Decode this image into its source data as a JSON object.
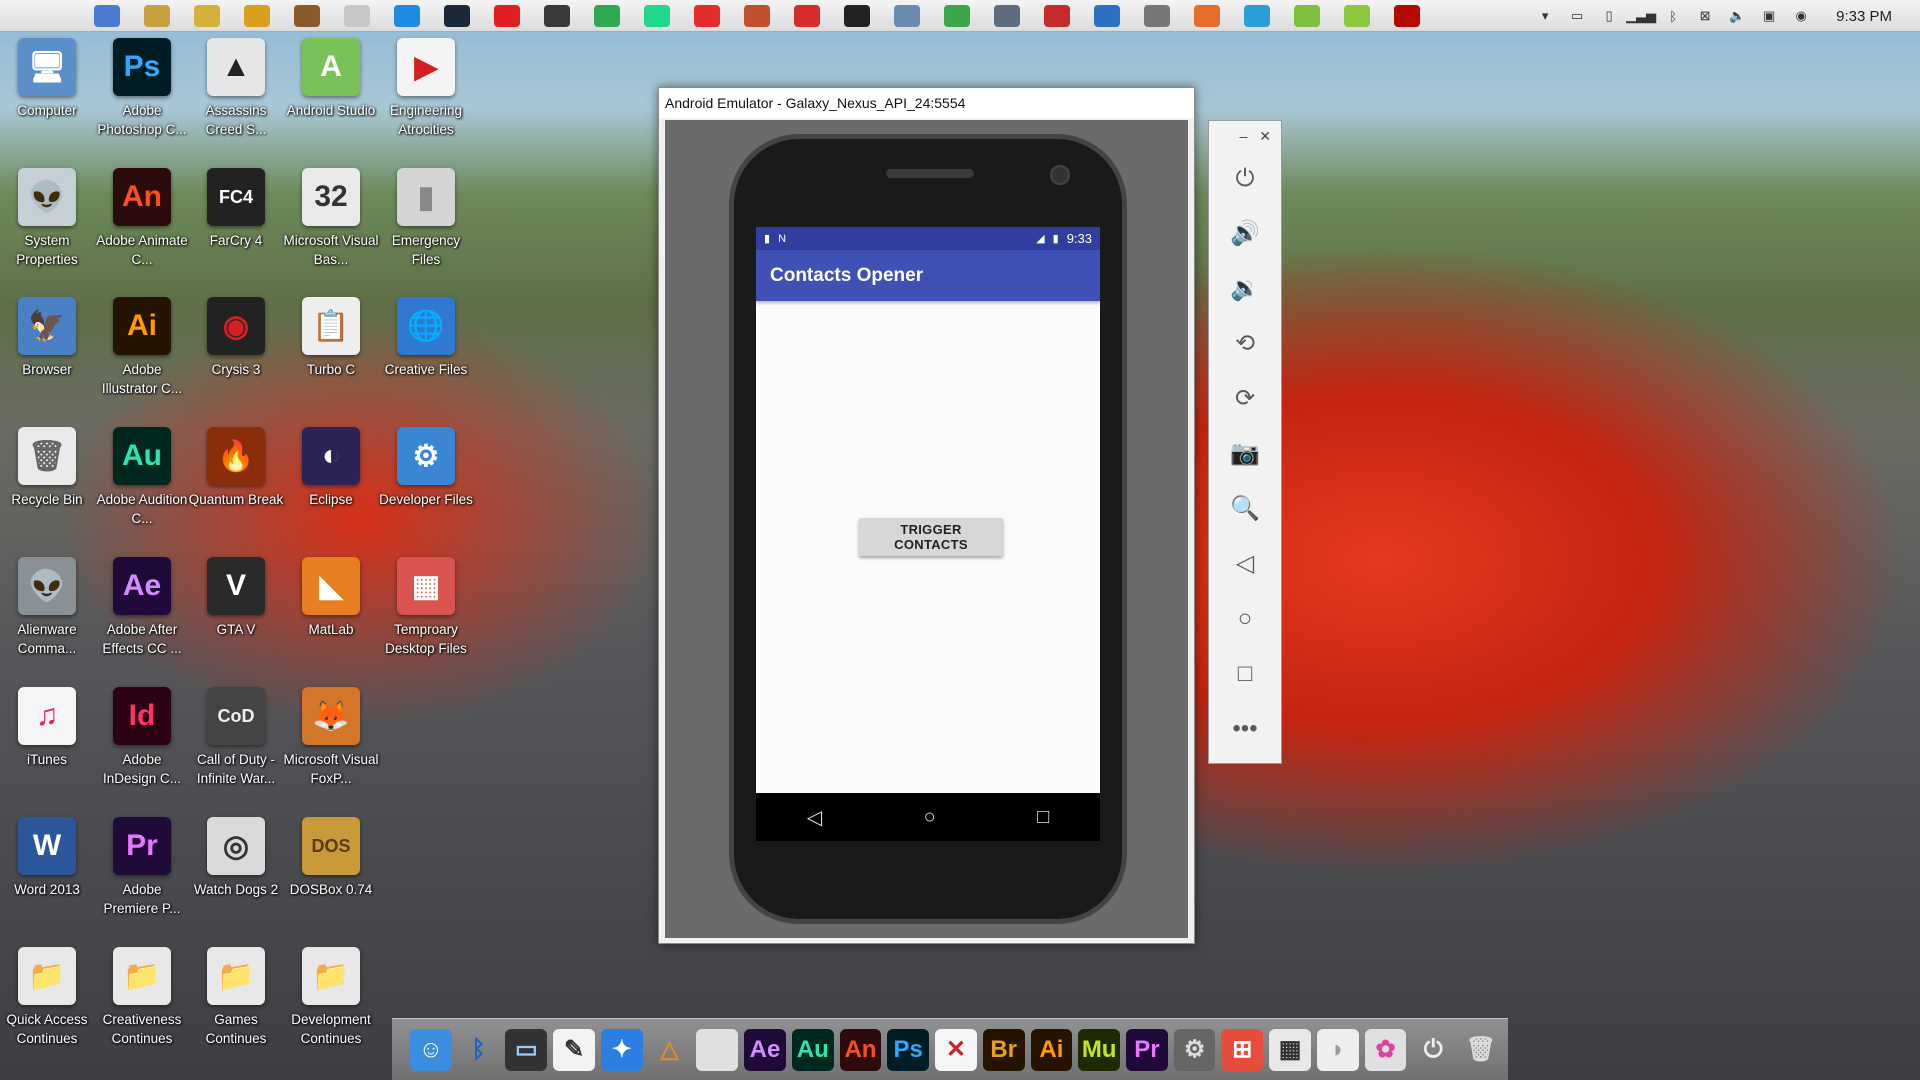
{
  "menubar": {
    "apple_glyph": "",
    "apps": [
      {
        "icon": "finder-icon",
        "color": "#4a7bd0"
      },
      {
        "icon": "folder-icon",
        "color": "#c9a23d"
      },
      {
        "icon": "bug-icon",
        "color": "#d4b13a"
      },
      {
        "icon": "r-app-icon",
        "color": "#d9a020"
      },
      {
        "icon": "box-icon",
        "color": "#8a5a2b"
      },
      {
        "icon": "leaf-icon",
        "color": "#c8c8c8"
      },
      {
        "icon": "gear-blue-icon",
        "color": "#1d8be0"
      },
      {
        "icon": "steam-icon",
        "color": "#1b2838"
      },
      {
        "icon": "m-red-icon",
        "color": "#e02020"
      },
      {
        "icon": "settings-icon",
        "color": "#3a3a3a"
      },
      {
        "icon": "green-doc-icon",
        "color": "#2fa84f"
      },
      {
        "icon": "pycharm-icon",
        "color": "#21d789"
      },
      {
        "icon": "download-icon",
        "color": "#e32d2d"
      },
      {
        "icon": "puzzle-icon",
        "color": "#c14f2d"
      },
      {
        "icon": "red-arrow-icon",
        "color": "#d42b2b"
      },
      {
        "icon": "chart-icon",
        "color": "#222222"
      },
      {
        "icon": "speed-icon",
        "color": "#6b8bb0"
      },
      {
        "icon": "globe-icon",
        "color": "#3aa64a"
      },
      {
        "icon": "chip-icon",
        "color": "#5d6d7e"
      },
      {
        "icon": "pdf-icon",
        "color": "#c72c2c"
      },
      {
        "icon": "shield-icon",
        "color": "#2d6fc2"
      },
      {
        "icon": "database-icon",
        "color": "#777777"
      },
      {
        "icon": "pen-icon",
        "color": "#e46d2a"
      },
      {
        "icon": "infinity-icon",
        "color": "#2a9fd6"
      },
      {
        "icon": "android-active-icon",
        "color": "#7fbf3f"
      },
      {
        "icon": "green-box-icon",
        "color": "#8dc63f"
      },
      {
        "icon": "acrobat-icon",
        "color": "#b30b00"
      }
    ],
    "tray": [
      "triangle-down-icon",
      "monitor-icon",
      "phone-icon",
      "signal-icon",
      "bluetooth-icon",
      "network-x-icon",
      "volume-icon",
      "display-icon",
      "chrome-icon"
    ],
    "clock": "9:33 PM"
  },
  "desktop": {
    "icons": [
      {
        "label": "Computer",
        "glyph": "🖥",
        "color": "#5b8fc9"
      },
      {
        "label": "Adobe Photoshop C...",
        "glyph": "Ps",
        "color": "#001d26",
        "fg": "#31a8ff"
      },
      {
        "label": "Assassins Creed S...",
        "glyph": "▲",
        "color": "#e6e6e6",
        "fg": "#222"
      },
      {
        "label": "Android Studio",
        "glyph": "A",
        "color": "#78c257",
        "fg": "#fff"
      },
      {
        "label": "Engineering Atrocities",
        "glyph": "▶",
        "color": "#f3f3f3",
        "fg": "#d42020"
      },
      {
        "label": "System Properties",
        "glyph": "👽",
        "color": "#c7cfd6",
        "fg": "#333"
      },
      {
        "label": "Adobe Animate C...",
        "glyph": "An",
        "color": "#2b0b0b",
        "fg": "#ff4f1f"
      },
      {
        "label": "FarCry 4",
        "glyph": "FC4",
        "color": "#222",
        "fg": "#fff"
      },
      {
        "label": "Microsoft Visual Bas...",
        "glyph": "32",
        "color": "#e9e9e9",
        "fg": "#333"
      },
      {
        "label": "Emergency Files",
        "glyph": "▮",
        "color": "#d4d4d4",
        "fg": "#888"
      },
      {
        "label": "Browser",
        "glyph": "🦅",
        "color": "#4a80c4",
        "fg": "#fff"
      },
      {
        "label": "Adobe Illustrator C...",
        "glyph": "Ai",
        "color": "#261300",
        "fg": "#ff9a00"
      },
      {
        "label": "Crysis 3",
        "glyph": "◉",
        "color": "#222",
        "fg": "#d42020"
      },
      {
        "label": "Turbo C",
        "glyph": "📋",
        "color": "#eee",
        "fg": "#333"
      },
      {
        "label": "Creative Files",
        "glyph": "🌐",
        "color": "#2f7ad0",
        "fg": "#fff"
      },
      {
        "label": "Recycle Bin",
        "glyph": "🗑",
        "color": "#eaeaea",
        "fg": "#666"
      },
      {
        "label": "Adobe Audition C...",
        "glyph": "Au",
        "color": "#00281f",
        "fg": "#2fe3b0"
      },
      {
        "label": "Quantum Break",
        "glyph": "🔥",
        "color": "#8a2d0a",
        "fg": "#ffb020"
      },
      {
        "label": "Eclipse",
        "glyph": "◐",
        "color": "#2c2255",
        "fg": "#fff"
      },
      {
        "label": "Developer Files",
        "glyph": "⚙",
        "color": "#3a86d4",
        "fg": "#fff"
      },
      {
        "label": "Alienware Comma...",
        "glyph": "👽",
        "color": "#8a9196",
        "fg": "#eee"
      },
      {
        "label": "Adobe After Effects CC ...",
        "glyph": "Ae",
        "color": "#1f0a3a",
        "fg": "#d48cff"
      },
      {
        "label": "GTA V",
        "glyph": "V",
        "color": "#2a2a2a",
        "fg": "#fff"
      },
      {
        "label": "MatLab",
        "glyph": "◣",
        "color": "#e67e22",
        "fg": "#fff"
      },
      {
        "label": "Temproary Desktop Files",
        "glyph": "▦",
        "color": "#d9534f",
        "fg": "#fff"
      },
      {
        "label": "iTunes",
        "glyph": "♫",
        "color": "#f5f5f5",
        "fg": "#e0245e"
      },
      {
        "label": "Adobe InDesign C...",
        "glyph": "Id",
        "color": "#2b0314",
        "fg": "#ff3366"
      },
      {
        "label": "Call of Duty - Infinite War...",
        "glyph": "CoD",
        "color": "#444",
        "fg": "#eee"
      },
      {
        "label": "Microsoft Visual FoxP...",
        "glyph": "🦊",
        "color": "#d4762a",
        "fg": "#fff"
      },
      {
        "label": "Word 2013",
        "glyph": "W",
        "color": "#2b579a",
        "fg": "#fff"
      },
      {
        "label": "Adobe Premiere P...",
        "glyph": "Pr",
        "color": "#1f0a3a",
        "fg": "#ea77ff"
      },
      {
        "label": "Watch Dogs 2",
        "glyph": "◎",
        "color": "#d9d9d9",
        "fg": "#333"
      },
      {
        "label": "DOSBox 0.74",
        "glyph": "DOS",
        "color": "#c99a3a",
        "fg": "#5a3a10"
      },
      {
        "label": "Quick Access Continues",
        "glyph": "📁",
        "color": "#e8e8e8",
        "fg": "#c22"
      },
      {
        "label": "Creativeness Continues",
        "glyph": "📁",
        "color": "#e8e8e8",
        "fg": "#3a3"
      },
      {
        "label": "Games Continues",
        "glyph": "📁",
        "color": "#e8e8e8",
        "fg": "#a83"
      },
      {
        "label": "Development Continues",
        "glyph": "📁",
        "color": "#e8e8e8",
        "fg": "#38c"
      }
    ]
  },
  "emulator": {
    "title": "Android Emulator - Galaxy_Nexus_API_24:5554",
    "status_time": "9:33",
    "app_title": "Contacts Opener",
    "button_label": "TRIGGER CONTACTS",
    "nav": {
      "back": "◁",
      "home": "○",
      "recents": "□"
    },
    "toolbar": {
      "minimize": "–",
      "close": "✕",
      "buttons": [
        {
          "name": "power-icon",
          "glyph": "⏻"
        },
        {
          "name": "volume-up-icon",
          "glyph": "🔊"
        },
        {
          "name": "volume-down-icon",
          "glyph": "🔉"
        },
        {
          "name": "rotate-left-icon",
          "glyph": "⟲"
        },
        {
          "name": "rotate-right-icon",
          "glyph": "⟳"
        },
        {
          "name": "camera-icon",
          "glyph": "📷"
        },
        {
          "name": "zoom-icon",
          "glyph": "🔍"
        },
        {
          "name": "back-icon",
          "glyph": "◁"
        },
        {
          "name": "home-icon",
          "glyph": "○"
        },
        {
          "name": "overview-icon",
          "glyph": "□"
        },
        {
          "name": "more-icon",
          "glyph": "•••"
        }
      ]
    }
  },
  "dock": {
    "items": [
      {
        "name": "finder-icon",
        "glyph": "☺",
        "color": "#3b8de0",
        "fg": "#fff"
      },
      {
        "name": "bluetooth-icon",
        "glyph": "ᛒ",
        "color": "transparent",
        "fg": "#1c5fcf"
      },
      {
        "name": "monitor-icon",
        "glyph": "▭",
        "color": "#333",
        "fg": "#9cf"
      },
      {
        "name": "notes-icon",
        "glyph": "✎",
        "color": "#f3f3f3",
        "fg": "#333"
      },
      {
        "name": "safari-icon",
        "glyph": "✦",
        "color": "#2a7fe0",
        "fg": "#fff"
      },
      {
        "name": "tools-icon",
        "glyph": "△",
        "color": "transparent",
        "fg": "#e08a2a"
      },
      {
        "name": "blank-doc-icon",
        "glyph": "",
        "color": "#e0e0e0",
        "fg": "#999"
      },
      {
        "name": "after-effects-icon",
        "glyph": "Ae",
        "color": "#1f0a3a",
        "fg": "#d48cff"
      },
      {
        "name": "audition-icon",
        "glyph": "Au",
        "color": "#00281f",
        "fg": "#2fe3b0"
      },
      {
        "name": "animate-icon",
        "glyph": "An",
        "color": "#2b0b0b",
        "fg": "#ff4f1f"
      },
      {
        "name": "photoshop-icon",
        "glyph": "Ps",
        "color": "#001d26",
        "fg": "#31a8ff"
      },
      {
        "name": "x-icon",
        "glyph": "✕",
        "color": "#f5f5f5",
        "fg": "#c22"
      },
      {
        "name": "bridge-icon",
        "glyph": "Br",
        "color": "#261300",
        "fg": "#e6a020"
      },
      {
        "name": "illustrator-icon",
        "glyph": "Ai",
        "color": "#261300",
        "fg": "#ff9a00"
      },
      {
        "name": "muse-icon",
        "glyph": "Mu",
        "color": "#1f2a00",
        "fg": "#c6e61f"
      },
      {
        "name": "premiere-icon",
        "glyph": "Pr",
        "color": "#1f0a3a",
        "fg": "#ea77ff"
      },
      {
        "name": "system-prefs-icon",
        "glyph": "⚙",
        "color": "#666",
        "fg": "#ddd"
      },
      {
        "name": "windows-icon",
        "glyph": "⊞",
        "color": "#e74c3c",
        "fg": "#fff"
      },
      {
        "name": "calculator-icon",
        "glyph": "▦",
        "color": "#e8e8e8",
        "fg": "#333"
      },
      {
        "name": "mouse-icon",
        "glyph": "◗",
        "color": "#eee",
        "fg": "#999"
      },
      {
        "name": "color-wheel-icon",
        "glyph": "✿",
        "color": "#e0e0e0",
        "fg": "#e040a0"
      },
      {
        "name": "power-icon",
        "glyph": "⏻",
        "color": "transparent",
        "fg": "#eee"
      },
      {
        "name": "trash-icon",
        "glyph": "🗑",
        "color": "transparent",
        "fg": "#ddd"
      }
    ]
  }
}
